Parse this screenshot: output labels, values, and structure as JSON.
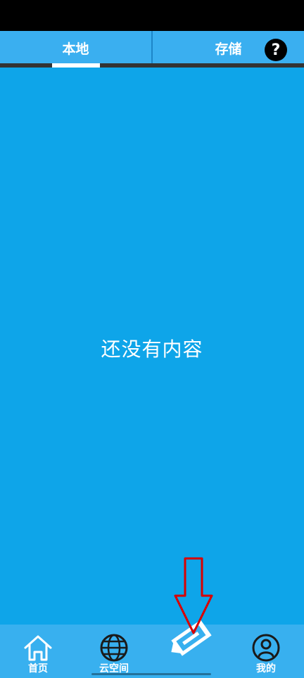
{
  "tabs": [
    {
      "label": "本地",
      "active": true
    },
    {
      "label": "存储",
      "active": false
    }
  ],
  "help_button": {
    "label": "?"
  },
  "main": {
    "empty_text": "还没有内容"
  },
  "bottom_nav": {
    "items": [
      {
        "label": "首页",
        "icon": "home-icon"
      },
      {
        "label": "云空间",
        "icon": "globe-icon"
      },
      {
        "label": "",
        "icon": "pencil-icon"
      },
      {
        "label": "我的",
        "icon": "user-icon"
      }
    ]
  },
  "colors": {
    "primary": "#0ea5e9",
    "tab_bar": "#3aaff0",
    "bottom_nav": "#38b0ef",
    "annotation_arrow": "#d90000"
  }
}
